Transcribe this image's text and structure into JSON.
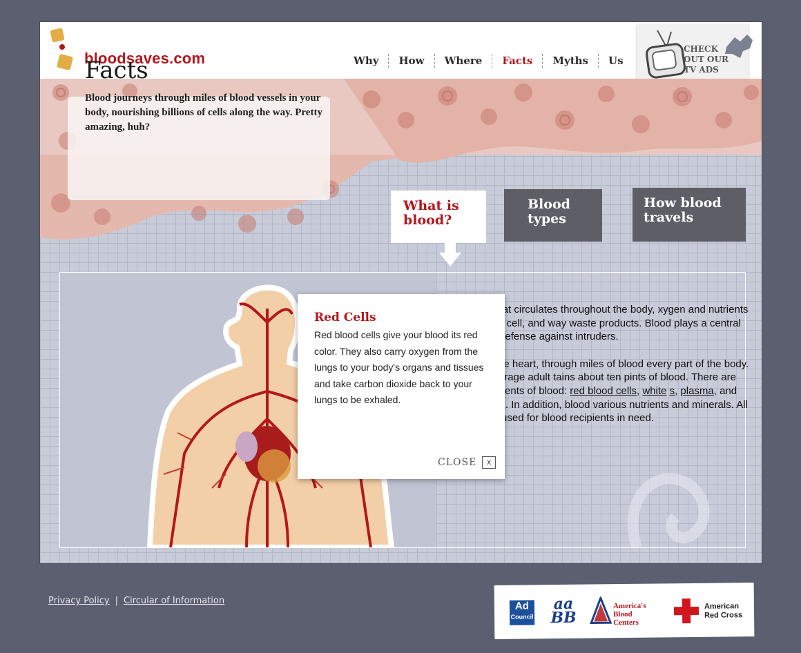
{
  "header": {
    "logo_text": "bloodsaves.com",
    "nav": [
      "Why",
      "How",
      "Where",
      "Facts",
      "Myths",
      "Us"
    ],
    "active_nav": "Facts",
    "tv_ads": "CHECK OUT OUR TV ADS"
  },
  "intro": {
    "title": "Facts",
    "text": "Blood journeys through miles of blood vessels in your body, nourishing billions of cells along the way. Pretty amazing, huh?"
  },
  "tabs": {
    "what": "What is blood?",
    "types": "Blood types",
    "travels": "How blood travels"
  },
  "content": {
    "paragraph1": "liquid that circulates throughout the body, xygen and nutrients to every cell, and way waste products. Blood plays a central body's defense against intruders.",
    "paragraph2_start": "ed by the heart, through miles of blood every part of the body. The average adult tains about ten pints of blood. There are four ponents of blood: ",
    "link_red": "red blood cells",
    "link_white": "white",
    "link_white_end": "s",
    "link_plasma": "plasma",
    "link_platelets": "platelets",
    "paragraph2_end": ". In addition, blood various nutrients and minerals. All nts are used for blood recipients in need."
  },
  "popup": {
    "title": "Red Cells",
    "text": "Red blood cells give your blood its red color. They also carry oxygen from the lungs to your body's organs and tissues and take carbon dioxide back to your lungs to be exhaled.",
    "close_label": "CLOSE",
    "close_x": "x"
  },
  "footer": {
    "privacy": "Privacy Policy",
    "separator": "|",
    "circular": "Circular of Information"
  },
  "partners": {
    "adcouncil_line1": "Ad",
    "adcouncil_line2": "Council",
    "aabb_line1": "aa",
    "aabb_line2": "BB",
    "abc_line1": "America's Blood",
    "abc_line2": "Centers",
    "redcross_line1": "American",
    "redcross_line2": "Red Cross"
  },
  "colors": {
    "brand_red": "#b3171c",
    "frame_bg": "#5b5f70",
    "tab_gray": "#5e5f66",
    "logo_gold": "#e2ad45"
  }
}
